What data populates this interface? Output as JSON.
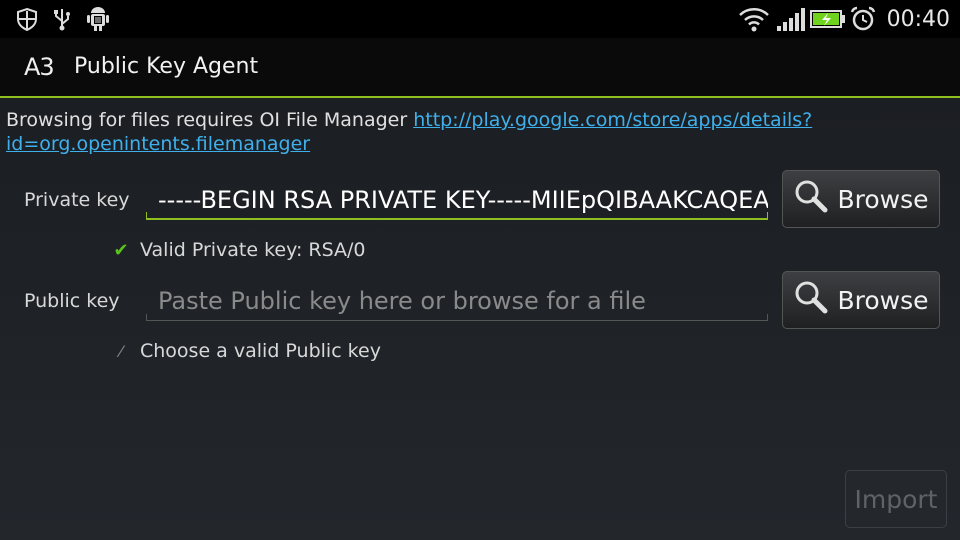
{
  "status_bar": {
    "left_icons": [
      "shield-icon",
      "usb-icon",
      "android-debug-icon"
    ],
    "right_icons": [
      "wifi-icon",
      "signal-icon",
      "battery-charging-icon",
      "alarm-icon"
    ],
    "time": "00:40"
  },
  "app": {
    "icon_text": "A3",
    "title": "Public Key Agent"
  },
  "notice": {
    "text": "Browsing for files requires OI File Manager ",
    "link": "http://play.google.com/store/apps/details?id=org.openintents.filemanager"
  },
  "private_key": {
    "label": "Private key",
    "value": "-----BEGIN RSA PRIVATE KEY-----MIIEpQIBAAKCAQEA",
    "browse_label": "Browse",
    "validation": "Valid Private key: RSA/0"
  },
  "public_key": {
    "label": "Public key",
    "placeholder": "Paste Public key here or browse for a file",
    "browse_label": "Browse",
    "validation": "Choose a valid Public key"
  },
  "import_label": "Import",
  "colors": {
    "accent": "#8fbf1e",
    "link": "#3fb0ec",
    "valid": "#58c21d"
  }
}
